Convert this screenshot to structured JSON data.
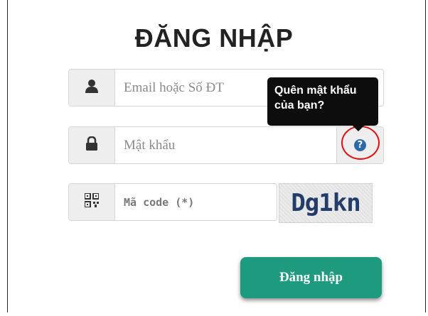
{
  "form": {
    "title": "ĐĂNG NHẬP",
    "email_placeholder": "Email hoặc Số ĐT",
    "password_placeholder": "Mật khẩu",
    "code_placeholder": "Mã code (*)",
    "captcha_text": "Dg1kn",
    "submit_label": "Đăng nhập"
  },
  "tooltip": {
    "line1": "Quên mật khẩu",
    "line2": "của bạn?"
  },
  "help_icon_glyph": "?",
  "icons": {
    "email": "user-icon",
    "password": "lock-icon",
    "code": "qrcode-icon",
    "help": "question-circle-icon"
  },
  "colors": {
    "submit_bg": "#1e9a7e",
    "help_icon": "#2a6aa8",
    "highlight_ring": "#e01010"
  }
}
